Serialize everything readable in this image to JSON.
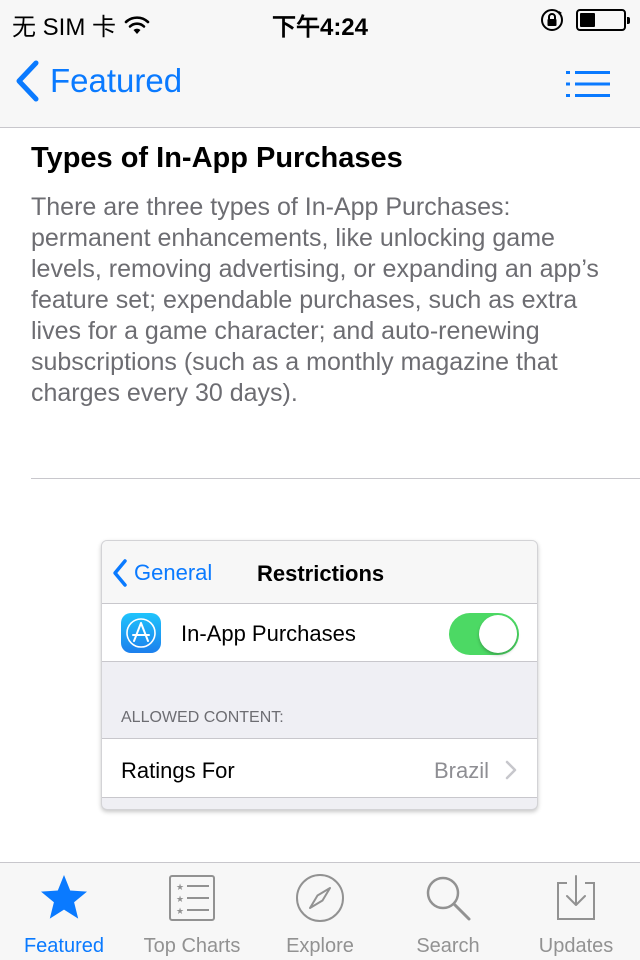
{
  "status_bar": {
    "carrier": "无 SIM 卡",
    "time": "下午4:24",
    "battery_level": 0.35
  },
  "nav": {
    "back_label": "Featured",
    "icons": {
      "back": "chevron-left-icon",
      "list": "list-icon"
    }
  },
  "article": {
    "title": "Types of In-App Purchases",
    "body": "There are three types of In-App Purchases: permanent enhancements, like unlocking game levels, removing advertising, or expanding an app’s feature set; expendable purchases, such as extra lives for a game character; and auto-renewing subscriptions (such as a monthly magazine that charges every 30 days)."
  },
  "figure": {
    "back_label": "General",
    "title": "Restrictions",
    "iap_label": "In-App Purchases",
    "iap_enabled": true,
    "section_header": "ALLOWED CONTENT:",
    "ratings_label": "Ratings For",
    "ratings_value": "Brazil"
  },
  "tab_bar": {
    "active": "Featured",
    "tabs": [
      {
        "label": "Featured",
        "icon": "star-icon"
      },
      {
        "label": "Top Charts",
        "icon": "top-charts-icon"
      },
      {
        "label": "Explore",
        "icon": "compass-icon"
      },
      {
        "label": "Search",
        "icon": "search-icon"
      },
      {
        "label": "Updates",
        "icon": "updates-icon"
      }
    ]
  },
  "colors": {
    "accent": "#0a7aff",
    "toggle_on": "#4cd964",
    "secondary_text": "#6d6d72",
    "tab_inactive": "#929292"
  }
}
